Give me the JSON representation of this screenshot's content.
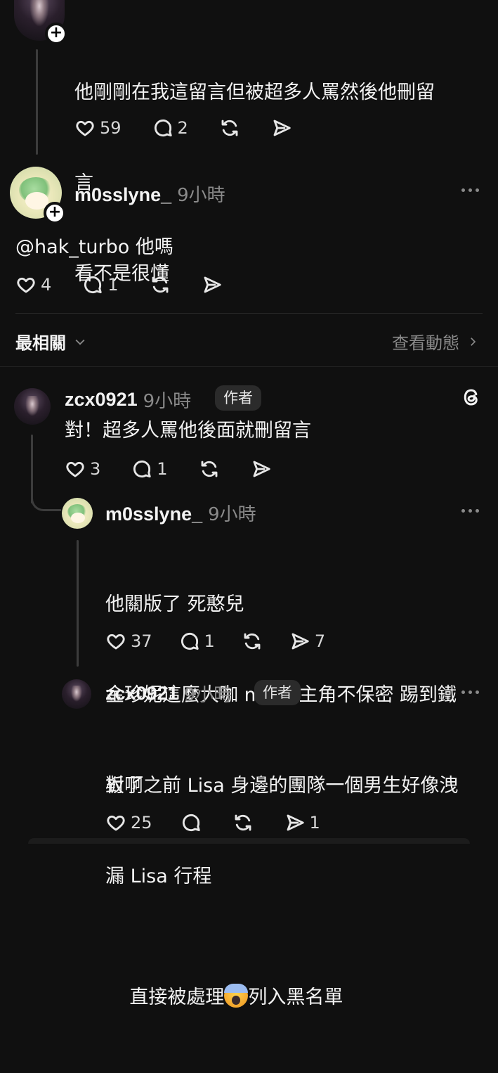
{
  "thread_top": {
    "text_lines": [
      "他剛剛在我這留言但被超多人罵然後他刪留",
      "言",
      "看不是很懂"
    ],
    "likes": "59",
    "replies": "2"
  },
  "comment1": {
    "username": "m0sslyne_",
    "time": "9小時",
    "text": "@hak_turbo 他嗎",
    "likes": "4",
    "replies": "1"
  },
  "sort_bar": {
    "sort_label": "最相關",
    "view_activity": "查看動態"
  },
  "comment2": {
    "username": "zcx0921",
    "time": "9小時",
    "badge": "作者",
    "text": "對！超多人罵他後面就刪留言",
    "likes": "3",
    "replies": "1"
  },
  "comment3": {
    "username": "m0sslyne_",
    "time": "9小時",
    "text_lines": [
      "他關版了 死憨兒",
      "金珍妮這麼大咖 mv 男主角不保密 踢到鐵",
      "板了"
    ],
    "likes": "37",
    "replies": "1",
    "shares": "7"
  },
  "comment4": {
    "username": "zcx0921",
    "time": "9小時",
    "badge": "作者",
    "text_lines": [
      "對啊之前 Lisa 身邊的團隊一個男生好像洩",
      "漏 Lisa 行程"
    ],
    "text_line3_before": "直接被處理",
    "emoji": "screaming-face",
    "text_line3_after": "列入黑名單",
    "likes": "25",
    "shares": "1"
  }
}
